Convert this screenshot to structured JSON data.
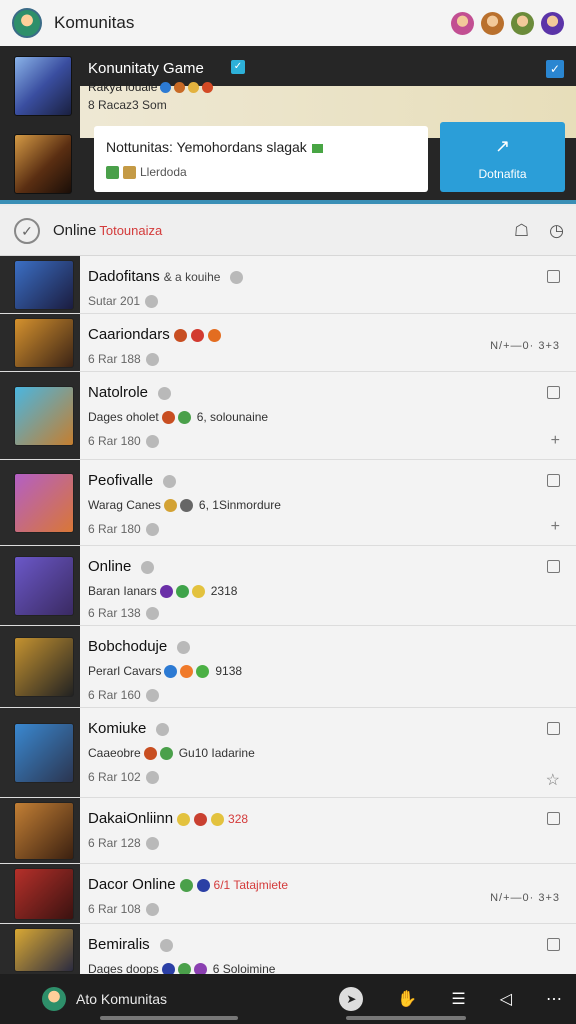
{
  "app": {
    "title": "Komunitas"
  },
  "top_avatars": [
    {
      "icon": "avatar-1",
      "color": "#c24f92"
    },
    {
      "icon": "avatar-2",
      "color": "#b9702d"
    },
    {
      "icon": "avatar-3",
      "color": "#6b8b3a"
    },
    {
      "icon": "avatar-4",
      "color": "#5b34a8"
    }
  ],
  "hero": {
    "title": "Konunitaty Game",
    "check_mark": "✓",
    "line1": "Rakya louale",
    "line2": "8 Racaz3 Som",
    "notice": {
      "title": "Nottunitas: Yemohordans slagak",
      "sub": "Llerdoda"
    },
    "cta": {
      "arrow": "↗",
      "label": "Dotnafita"
    }
  },
  "filter": {
    "check": "✓",
    "label": "Online",
    "sub": "Totounaiza",
    "icons": [
      "☖",
      "◷"
    ]
  },
  "rows": [
    {
      "title": "Dadofitans",
      "extra": "& a kouihe",
      "meta": "Sutar 201",
      "thumb": [
        "#3b6fc4",
        "#1b1c3f"
      ],
      "right": "square"
    },
    {
      "title": "Caariondars",
      "extra": "",
      "meta": "6 Rar 188",
      "sub_dots": [
        "#c84e21",
        "#d23a30",
        "#e36d20"
      ],
      "thumb": [
        "#d4912e",
        "#3b2315"
      ],
      "right": "controls",
      "controls": "N/+—0· 3+3"
    },
    {
      "title": "Natolrole",
      "extra": "",
      "meta": "6 Rar 180",
      "sub": "Dages oholet",
      "sub_tail": "6, solounaine",
      "sub_dots": [
        "#c84e21",
        "#4aa04a"
      ],
      "thumb": [
        "#4ab6e0",
        "#c57e2f"
      ],
      "right": "square-plus"
    },
    {
      "title": "Peofivalle",
      "extra": "",
      "meta": "6 Rar 180",
      "sub": "Warag Canes",
      "sub_tail": "6, 1Sinmordure",
      "sub_dots": [
        "#d3a234",
        "#666"
      ],
      "thumb": [
        "#b35fc5",
        "#d97736"
      ],
      "right": "square-plus"
    },
    {
      "title": "Online",
      "extra": "",
      "meta": "6 Rar 138",
      "sub": "Baran Ianars",
      "sub_tail": "2318",
      "sub_dots": [
        "#6a2fa7",
        "#3fa34a",
        "#e3c23e"
      ],
      "thumb": [
        "#6b58c8",
        "#3a2a62"
      ],
      "right": "square"
    },
    {
      "title": "Bobchoduje",
      "extra": "",
      "meta": "6 Rar 160",
      "sub": "Perarl Cavars",
      "sub_tail": "9138",
      "sub_dots": [
        "#2c7ad3",
        "#f07a2a",
        "#4bb044"
      ],
      "thumb": [
        "#c49230",
        "#222"
      ],
      "right": "none"
    },
    {
      "title": "Komiuke",
      "extra": "",
      "meta": "6 Rar 102",
      "sub": "Caaeobre",
      "sub_tail": "Gu10 Iadarine",
      "sub_dots": [
        "#c84e21",
        "#4aa04a"
      ],
      "thumb": [
        "#3a88d0",
        "#2b3550"
      ],
      "right": "square-star"
    },
    {
      "title": "DakaiOnliinn",
      "extra": "",
      "meta": "6 Rar 128",
      "sub": "",
      "sub_tail": "328",
      "sub_dots": [
        "#e3c23e",
        "#c94030",
        "#e3c23e"
      ],
      "thumb": [
        "#c27f35",
        "#3b2010"
      ],
      "right": "square",
      "inline_dots": true
    },
    {
      "title": "Dacor Online",
      "extra": "",
      "meta": "6 Rar 108",
      "sub": "",
      "sub_tail": "6/1 Tatajmiete",
      "sub_dots": [
        "#4aa04a",
        "#2b3fa5"
      ],
      "thumb": [
        "#b5302a",
        "#3a1210"
      ],
      "right": "controls",
      "controls": "N/+—0· 3+3",
      "inline_dots": true
    },
    {
      "title": "Bemiralis",
      "extra": "",
      "meta": "",
      "sub": "Daqes doops",
      "sub_tail": "6 Soloimine",
      "sub_dots": [
        "#2b3fa5",
        "#4aa04a",
        "#8a3fb0"
      ],
      "thumb": [
        "#d9a834",
        "#2b2b40"
      ],
      "right": "square"
    }
  ],
  "bottom": {
    "label": "Ato Komunitas",
    "icons": [
      "compass-icon",
      "hand-icon",
      "list-icon",
      "back-icon",
      "more-icon"
    ]
  }
}
